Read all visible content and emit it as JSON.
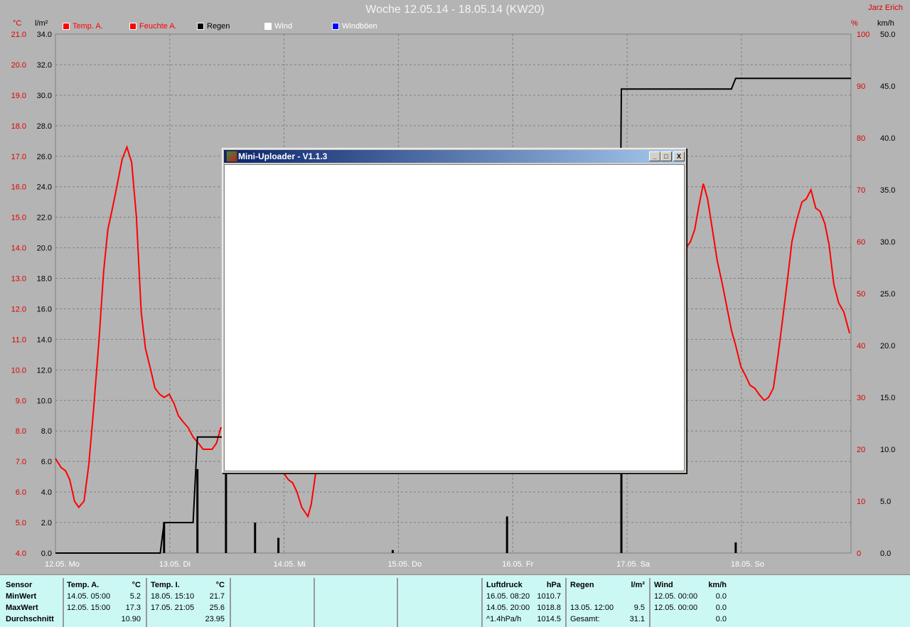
{
  "header": {
    "title": "Woche 12.05.14 - 18.05.14 (KW20)",
    "author": "Jarz Erich"
  },
  "units": {
    "temp": "°C",
    "rain": "l/m²",
    "humidity": "%",
    "wind": "km/h"
  },
  "legend": [
    {
      "label": "Temp. A.",
      "color": "#ff0000",
      "text_color": "#ff0000"
    },
    {
      "label": "Feuchte A.",
      "color": "#ff0000",
      "text_color": "#ff0000"
    },
    {
      "label": "Regen",
      "color": "#000000",
      "text_color": "#000000"
    },
    {
      "label": "Wind",
      "color": "#ffffff",
      "text_color": "#ffffff"
    },
    {
      "label": "Windböen",
      "color": "#0000ff",
      "text_color": "#ffffff"
    }
  ],
  "chart_data": {
    "type": "line",
    "x_unit": "hours since 12.05. 00:00",
    "xlim": [
      0,
      167
    ],
    "x_ticks": [
      "12.05. Mo",
      "13.05. Di",
      "14.05. Mi",
      "15.05. Do",
      "16.05. Fr",
      "17.05. Sa",
      "18.05. So"
    ],
    "axes": {
      "temp": {
        "range": [
          4,
          21
        ],
        "ticks": [
          "4.0",
          "5.0",
          "6.0",
          "7.0",
          "8.0",
          "9.0",
          "10.0",
          "11.0",
          "12.0",
          "13.0",
          "14.0",
          "15.0",
          "16.0",
          "17.0",
          "18.0",
          "19.0",
          "20.0",
          "21.0"
        ]
      },
      "rain": {
        "range": [
          0,
          34
        ],
        "ticks": [
          "0.0",
          "2.0",
          "4.0",
          "6.0",
          "8.0",
          "10.0",
          "12.0",
          "14.0",
          "16.0",
          "18.0",
          "20.0",
          "22.0",
          "24.0",
          "26.0",
          "28.0",
          "30.0",
          "32.0",
          "34.0"
        ]
      },
      "humidity": {
        "range": [
          0,
          100
        ],
        "ticks": [
          "0",
          "10",
          "20",
          "30",
          "40",
          "50",
          "60",
          "70",
          "80",
          "90",
          "100"
        ]
      },
      "wind": {
        "range": [
          0,
          50
        ],
        "ticks": [
          "0.0",
          "5.0",
          "10.0",
          "15.0",
          "20.0",
          "25.0",
          "30.0",
          "35.0",
          "40.0",
          "45.0",
          "50.0"
        ]
      }
    },
    "series": [
      {
        "name": "Temp. A.",
        "axis": "temp",
        "color": "#ff0000",
        "points": [
          [
            0,
            7.1
          ],
          [
            1.2,
            6.8
          ],
          [
            2.1,
            6.7
          ],
          [
            3,
            6.4
          ],
          [
            4,
            5.7
          ],
          [
            4.9,
            5.5
          ],
          [
            6,
            5.7
          ],
          [
            7,
            6.9
          ],
          [
            8,
            8.7
          ],
          [
            9.1,
            10.9
          ],
          [
            10.1,
            13.2
          ],
          [
            11,
            14.6
          ],
          [
            12.1,
            15.4
          ],
          [
            13,
            16.1
          ],
          [
            14,
            16.9
          ],
          [
            15,
            17.3
          ],
          [
            16,
            16.8
          ],
          [
            17,
            15.0
          ],
          [
            18,
            11.9
          ],
          [
            18.9,
            10.7
          ],
          [
            20,
            10.0
          ],
          [
            20.9,
            9.4
          ],
          [
            21.9,
            9.2
          ],
          [
            22.8,
            9.1
          ],
          [
            23.9,
            9.2
          ],
          [
            24.9,
            8.9
          ],
          [
            25.8,
            8.5
          ],
          [
            26.8,
            8.3
          ],
          [
            27.9,
            8.1
          ],
          [
            28.9,
            7.8
          ],
          [
            30,
            7.6
          ],
          [
            31,
            7.4
          ],
          [
            31.9,
            7.4
          ],
          [
            32.9,
            7.4
          ],
          [
            33.8,
            7.6
          ],
          [
            34.7,
            8.1
          ],
          [
            41,
            8.0
          ],
          [
            48,
            6.6
          ],
          [
            48.9,
            6.4
          ],
          [
            49.8,
            6.3
          ],
          [
            50.7,
            6.0
          ],
          [
            51.7,
            5.5
          ],
          [
            53,
            5.2
          ],
          [
            53.7,
            5.6
          ],
          [
            54.6,
            6.6
          ],
          [
            60,
            12
          ],
          [
            132.4,
            14.0
          ],
          [
            133.3,
            14.2
          ],
          [
            134.2,
            14.6
          ],
          [
            135.1,
            15.4
          ],
          [
            136,
            16.1
          ],
          [
            136.9,
            15.6
          ],
          [
            137.7,
            14.8
          ],
          [
            138.9,
            13.6
          ],
          [
            140,
            12.8
          ],
          [
            140.9,
            12.1
          ],
          [
            141.9,
            11.3
          ],
          [
            142.8,
            10.8
          ],
          [
            143.9,
            10.1
          ],
          [
            144.9,
            9.8
          ],
          [
            145.8,
            9.5
          ],
          [
            146.8,
            9.4
          ],
          [
            147.7,
            9.2
          ],
          [
            148.8,
            9.0
          ],
          [
            149.7,
            9.1
          ],
          [
            150.7,
            9.4
          ],
          [
            151.7,
            10.5
          ],
          [
            152.6,
            11.6
          ],
          [
            153.7,
            13.0
          ],
          [
            154.6,
            14.2
          ],
          [
            155.6,
            14.9
          ],
          [
            156.7,
            15.5
          ],
          [
            157.6,
            15.6
          ],
          [
            158.6,
            15.9
          ],
          [
            159.6,
            15.3
          ],
          [
            160.5,
            15.2
          ],
          [
            161.5,
            14.8
          ],
          [
            162.4,
            14.1
          ],
          [
            163.4,
            12.8
          ],
          [
            164.4,
            12.2
          ],
          [
            165.5,
            11.9
          ],
          [
            166.7,
            11.2
          ]
        ]
      },
      {
        "name": "Regen",
        "axis": "rain",
        "color": "#000000",
        "step": true,
        "points": [
          [
            0,
            0
          ],
          [
            22,
            0
          ],
          [
            22.8,
            2.0
          ],
          [
            28.9,
            2.0
          ],
          [
            29.8,
            7.6
          ],
          [
            35.8,
            7.6
          ],
          [
            35.8,
            17.1
          ],
          [
            41.9,
            19.1
          ],
          [
            46.8,
            20.1
          ],
          [
            70.8,
            20.3
          ],
          [
            94.8,
            22.7
          ],
          [
            118.6,
            22.7
          ],
          [
            118.8,
            30.4
          ],
          [
            141.9,
            30.4
          ],
          [
            142.8,
            31.1
          ],
          [
            167,
            31.1
          ]
        ]
      },
      {
        "name": "Regen (Balken)",
        "axis": "rain",
        "color": "#000000",
        "type": "bar",
        "points": [
          [
            22.8,
            2.0
          ],
          [
            29.8,
            5.5
          ],
          [
            35.8,
            9.5
          ],
          [
            41.9,
            2.0
          ],
          [
            46.8,
            1.0
          ],
          [
            70.8,
            0.2
          ],
          [
            94.8,
            2.4
          ],
          [
            118.8,
            6.0
          ],
          [
            142.8,
            0.7
          ]
        ]
      }
    ]
  },
  "stats": {
    "labels": {
      "sensor": "Sensor",
      "min": "MinWert",
      "max": "MaxWert",
      "avg": "Durchschnitt"
    },
    "temp_a": {
      "name": "Temp. A.",
      "unit": "°C",
      "min_time": "14.05.  05:00",
      "min": "5.2",
      "max_time": "12.05.  15:00",
      "max": "17.3",
      "avg": "10.90"
    },
    "temp_i": {
      "name": "Temp. I.",
      "unit": "°C",
      "min_time": "18.05.  15:10",
      "min": "21.7",
      "max_time": "17.05.  21:05",
      "max": "25.6",
      "avg": "23.95"
    },
    "pressure": {
      "name": "Luftdruck",
      "unit": "hPa",
      "min_time": "16.05.  08:20",
      "min": "1010.7",
      "max_time": "14.05.  20:00",
      "max": "1018.8",
      "trend": "^1.4hPa/h",
      "avg": "1014.5"
    },
    "rain": {
      "name": "Regen",
      "unit": "l/m²",
      "max_time": "13.05.  12:00",
      "max": "9.5",
      "total_label": "Gesamt:",
      "total": "31.1"
    },
    "wind": {
      "name": "Wind",
      "unit": "km/h",
      "min_time": "12.05.  00:00",
      "min": "0.0",
      "max_time": "12.05.  00:00",
      "max": "0.0",
      "avg": "0.0"
    }
  },
  "dialog": {
    "title": "Mini-Uploader - V1.1.3",
    "minimize": "_",
    "maximize": "□",
    "close": "X"
  }
}
